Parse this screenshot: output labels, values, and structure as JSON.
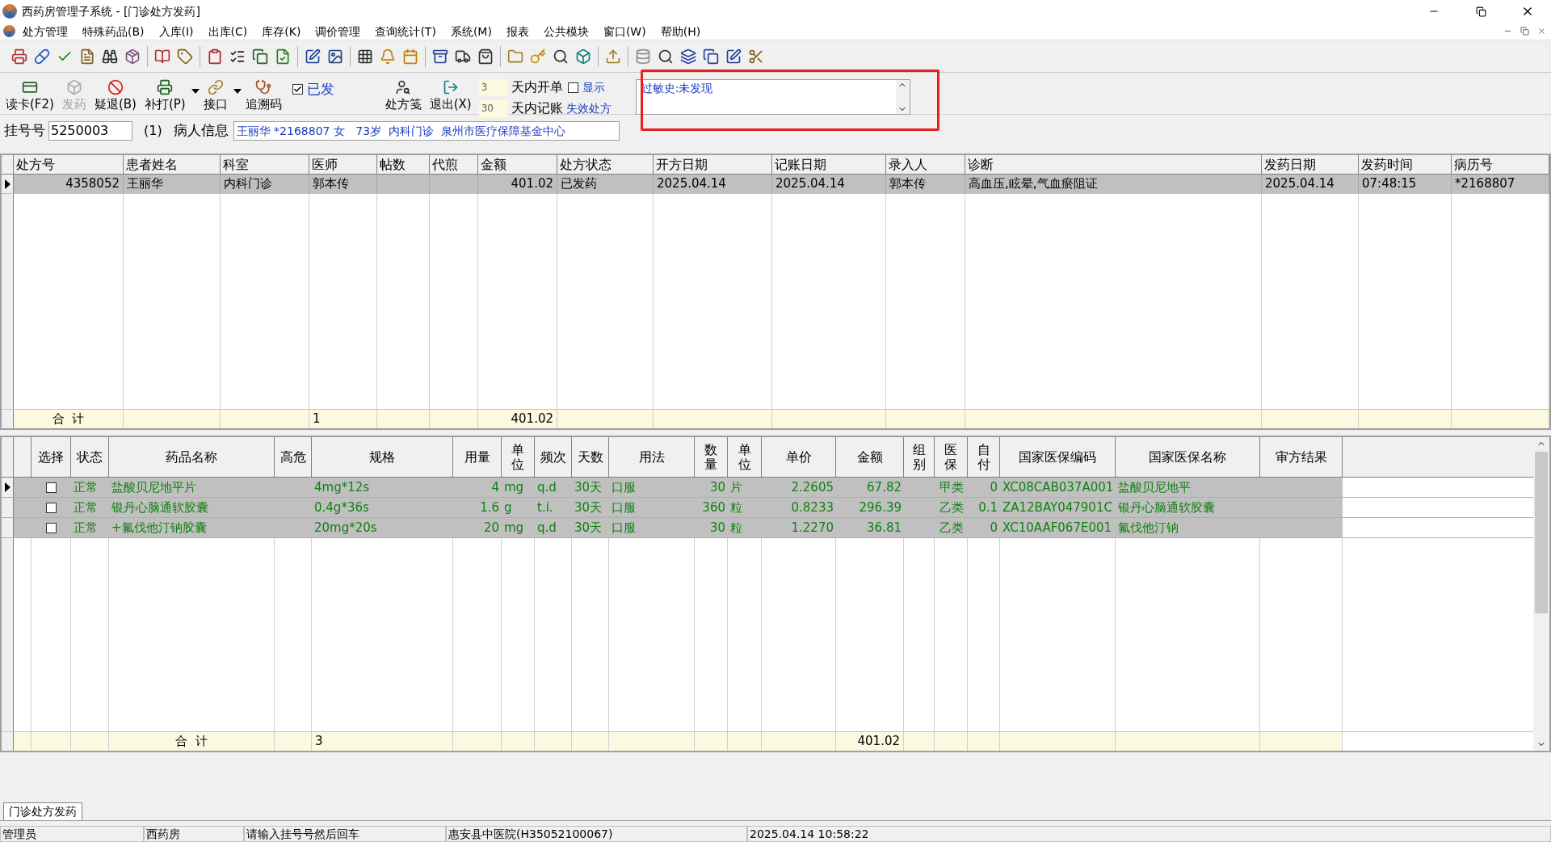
{
  "window": {
    "title": "西药房管理子系统 - [门诊处方发药]"
  },
  "menu_bar": [
    "处方管理",
    "特殊药品(B)",
    "入库(I)",
    "出库(C)",
    "库存(K)",
    "调价管理",
    "查询统计(T)",
    "系统(M)",
    "报表",
    "公共模块",
    "窗口(W)",
    "帮助(H)"
  ],
  "action_bar": {
    "buttons": [
      {
        "label": "读卡(F2)",
        "disabled": false,
        "has_dropdown": false
      },
      {
        "label": "发药",
        "disabled": true,
        "has_dropdown": false
      },
      {
        "label": "疑退(B)",
        "disabled": false,
        "has_dropdown": false
      },
      {
        "label": "补打(P)",
        "disabled": false,
        "has_dropdown": true
      },
      {
        "label": "接口",
        "disabled": false,
        "has_dropdown": true
      },
      {
        "label": "追溯码",
        "disabled": false,
        "has_dropdown": false
      }
    ],
    "dispensed_checkbox": {
      "label": "已发",
      "checked": true
    },
    "buttons_right": [
      {
        "label": "处方笺",
        "disabled": false,
        "has_dropdown": false
      },
      {
        "label": "退出(X)",
        "disabled": false,
        "has_dropdown": false
      }
    ],
    "day_filters": [
      {
        "value": "3",
        "label": "天内开单"
      },
      {
        "value": "30",
        "label": "天内记账"
      }
    ],
    "show_checkbox": {
      "label": "显示",
      "checked": false
    },
    "expired_link": "失效处方",
    "allergy_memo": "过敏史:未发现"
  },
  "registration": {
    "label": "挂号号",
    "value": "5250003",
    "count": "(1)",
    "patient_label": "病人信息",
    "patient_info": "王丽华 *2168807 女   73岁  内科门诊  泉州市医疗保障基金中心"
  },
  "prescription_table": {
    "columns": [
      {
        "title": "处方号",
        "total": "合  计"
      },
      {
        "title": "患者姓名"
      },
      {
        "title": "科室"
      },
      {
        "title": "医师",
        "total": "1"
      },
      {
        "title": "帖数"
      },
      {
        "title": "代煎"
      },
      {
        "title": "金额",
        "total": "401.02"
      },
      {
        "title": "处方状态"
      },
      {
        "title": "开方日期"
      },
      {
        "title": "记账日期"
      },
      {
        "title": "录入人"
      },
      {
        "title": "诊断"
      },
      {
        "title": "发药日期"
      },
      {
        "title": "发药时间"
      },
      {
        "title": "病历号"
      }
    ],
    "rows": [
      {
        "selected": true,
        "no": "4358052",
        "patient": "王丽华",
        "dept": "内科门诊",
        "doctor": "郭本传",
        "amount": "401.02",
        "status": "已发药",
        "rx_date": "2025.04.14",
        "bill_date": "2025.04.14",
        "entered_by": "郭本传",
        "diagnosis": "高血压,眩晕,气血瘀阻证",
        "dispense_date": "2025.04.14",
        "dispense_time": "07:48:15",
        "record_no": "*2168807"
      }
    ]
  },
  "drug_table": {
    "columns": [
      {
        "title": "选择"
      },
      {
        "title": "状态"
      },
      {
        "title": "药品名称",
        "total": "合  计"
      },
      {
        "title": "高危"
      },
      {
        "title": "规格",
        "total": "3"
      },
      {
        "title": "用量"
      },
      {
        "title": "单位"
      },
      {
        "title": "频次"
      },
      {
        "title": "天数"
      },
      {
        "title": "用法"
      },
      {
        "title": "数量"
      },
      {
        "title": "单位"
      },
      {
        "title": "单价"
      },
      {
        "title": "金额",
        "total": "401.02"
      },
      {
        "title": "组别"
      },
      {
        "title": "医保"
      },
      {
        "title": "自付"
      },
      {
        "title": "国家医保编码"
      },
      {
        "title": "国家医保名称"
      },
      {
        "title": "审方结果"
      }
    ],
    "rows": [
      {
        "selected": true,
        "checked": false,
        "status": "正常",
        "drug": "盐酸贝尼地平片",
        "spec": "4mg*12s",
        "dose": "4",
        "dose_unit": "mg",
        "freq": "q.d",
        "days": "30天",
        "route": "口服",
        "qty": "30",
        "unit": "片",
        "price": "2.2605",
        "amount": "67.82",
        "insurance": "甲类",
        "self_pay": "0",
        "nhsa_code": "XC08CAB037A001",
        "nhsa_name": "盐酸贝尼地平"
      },
      {
        "selected": false,
        "checked": false,
        "status": "正常",
        "drug": "银丹心脑通软胶囊",
        "spec": "0.4g*36s",
        "dose": "1.6",
        "dose_unit": "g",
        "freq": "t.i.",
        "days": "30天",
        "route": "口服",
        "qty": "360",
        "unit": "粒",
        "price": "0.8233",
        "amount": "296.39",
        "insurance": "乙类",
        "self_pay": "0.1",
        "nhsa_code": "ZA12BAY047901C",
        "nhsa_name": "银丹心脑通软胶囊"
      },
      {
        "selected": false,
        "checked": false,
        "status": "正常",
        "drug": "+氟伐他汀钠胶囊",
        "spec": "20mg*20s",
        "dose": "20",
        "dose_unit": "mg",
        "freq": "q.d",
        "days": "30天",
        "route": "口服",
        "qty": "30",
        "unit": "粒",
        "price": "1.2270",
        "amount": "36.81",
        "insurance": "乙类",
        "self_pay": "0",
        "nhsa_code": "XC10AAF067E001",
        "nhsa_name": "氟伐他汀钠"
      }
    ]
  },
  "document_tab": {
    "label": "门诊处方发药",
    "selected": true
  },
  "status_bar": [
    "管理员",
    "西药房",
    "请输入挂号号然后回车",
    "惠安县中医院(H35052100067)",
    "2025.04.14 10:58:22"
  ]
}
